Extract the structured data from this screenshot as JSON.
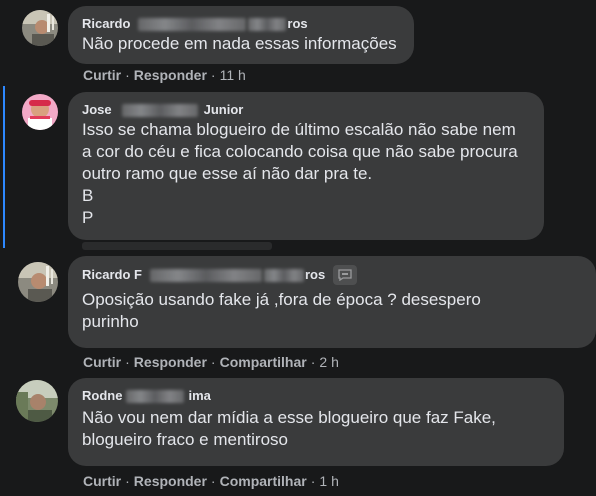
{
  "actions": {
    "like": "Curtir",
    "reply": "Responder",
    "share": "Compartilhar",
    "separator": "·"
  },
  "comments": [
    {
      "name_start": "Ricardo",
      "name_end": "ros",
      "lines": [
        "Não procede em nada essas informações"
      ],
      "time": "11 h"
    },
    {
      "name_start": "Jose",
      "name_end": "Junior",
      "lines": [
        "Isso se chama blogueiro de último escalão não sabe nem",
        "a cor do céu e fica colocando coisa que não sabe procura",
        "outro ramo que esse aí não dar pra te.",
        "B",
        "P"
      ]
    },
    {
      "name_start": "Ricardo F",
      "name_end": "ros",
      "lines": [
        "Oposição usando fake já ,fora de época ? desespero",
        "purinho"
      ],
      "time": "2 h"
    },
    {
      "name_start": "Rodne",
      "name_end": "ima",
      "lines": [
        "Não vou nem dar mídia a esse blogueiro que faz Fake,",
        "blogueiro fraco e mentiroso"
      ],
      "time": "1 h"
    }
  ],
  "colors": {
    "background": "#18191a",
    "bubble": "#3a3b3c",
    "text": "#e4e6eb",
    "secondary": "#b0b3b8",
    "thread_line": "#2d88ff"
  },
  "icons": [
    "avatar-ricardo",
    "avatar-jose",
    "avatar-rodney",
    "chat-badge-icon"
  ]
}
